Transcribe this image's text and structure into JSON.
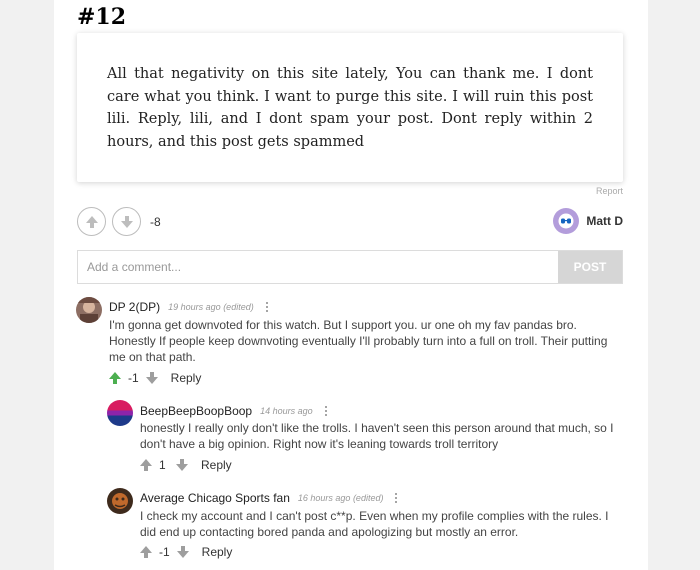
{
  "post": {
    "number": "#12",
    "text": "All that negativity on this site lately, You can thank me. I dont care what you think. I want to purge this site. I will ruin this post lili. Reply, lili, and I dont spam your post. Dont reply within 2 hours, and this post gets spammed",
    "report_label": "Report",
    "score": "-8",
    "author": "Matt D",
    "icons": {
      "upvote": "arrow-up-icon",
      "downvote": "arrow-down-icon",
      "more": "vertical-dots-icon"
    }
  },
  "comment_form": {
    "placeholder": "Add a comment...",
    "post_label": "POST"
  },
  "comments": [
    {
      "user": "DP 2(DP)",
      "time": "19 hours ago",
      "edited": "(edited)",
      "text": "I'm gonna get downvoted for this watch. But I support you. ur one oh my fav pandas bro. Honestly If people keep downvoting eventually I'll probably turn into a full on troll. Their putting me on that path.",
      "score": "-1",
      "reply_label": "Reply",
      "upvoted": true
    },
    {
      "user": "BeepBeepBoopBoop",
      "time": "14 hours ago",
      "edited": "",
      "text": "honestly I really only don't like the trolls. I haven't seen this person around that much, so I don't have a big opinion. Right now it's leaning towards troll territory",
      "score": "1",
      "reply_label": "Reply",
      "upvoted": false
    },
    {
      "user": "Average Chicago Sports fan",
      "time": "16 hours ago",
      "edited": "(edited)",
      "text": "I check my account and I can't post c**p. Even when my profile complies with the rules. I did end up contacting bored panda and apologizing but mostly an error.",
      "score": "-1",
      "reply_label": "Reply",
      "upvoted": false
    }
  ],
  "colors": {
    "upvote_active": "#4caf50",
    "vote_inactive": "#9e9e9e",
    "post_button": "#d6d6d6",
    "author_avatar": "#b39ddb"
  }
}
